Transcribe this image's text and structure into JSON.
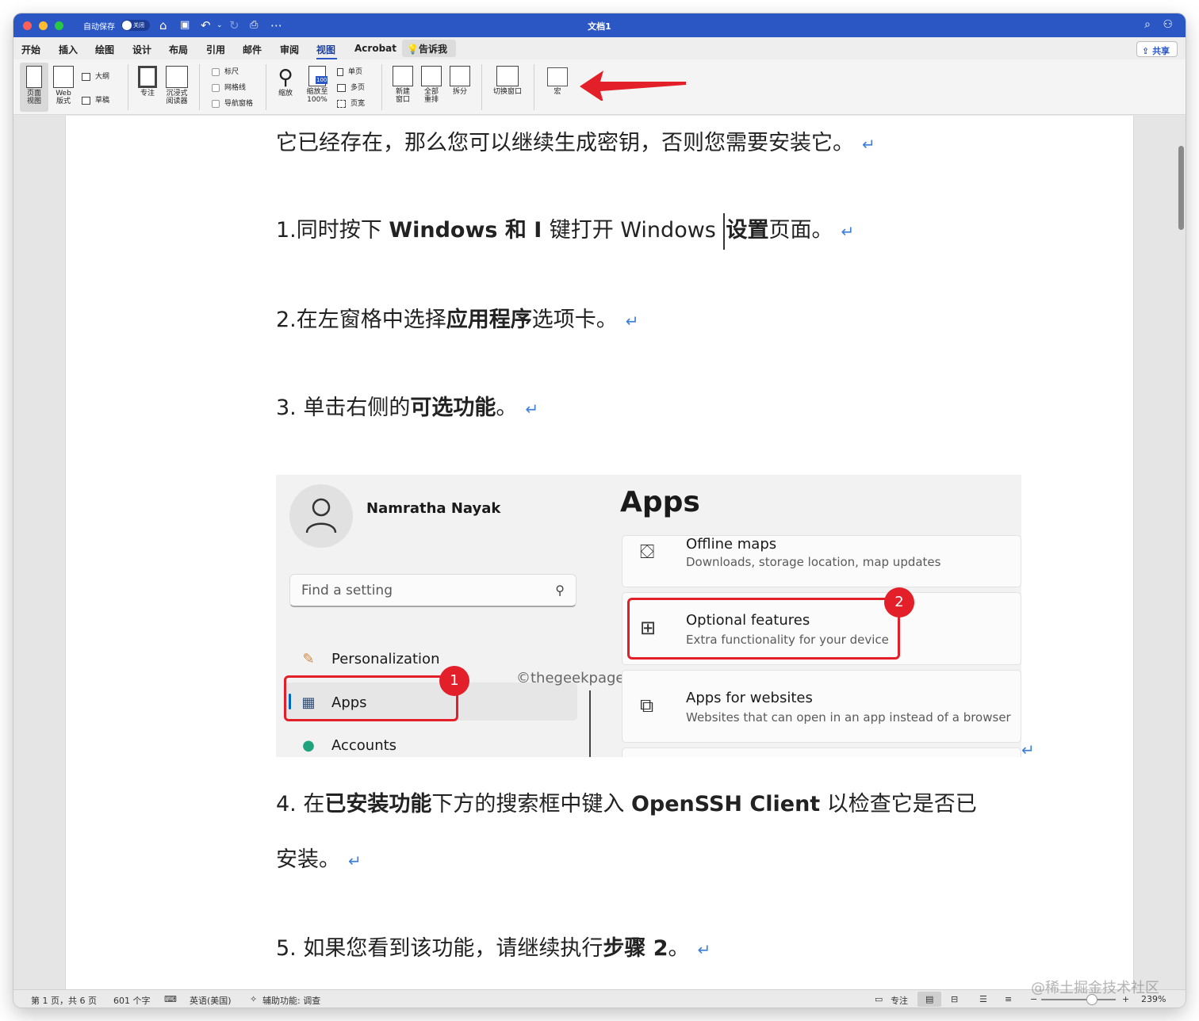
{
  "titlebar": {
    "autosave_label": "自动保存",
    "autosave_state": "关闭",
    "doc_title": "文档1"
  },
  "tabs": [
    "开始",
    "插入",
    "绘图",
    "设计",
    "布局",
    "引用",
    "邮件",
    "审阅",
    "视图",
    "Acrobat"
  ],
  "active_tab": "视图",
  "tellme": "告诉我",
  "share": "共享",
  "ribbon": {
    "page_view": "页面\n视图",
    "web_layout": "Web\n版式",
    "outline": "大纲",
    "draft": "草稿",
    "focus": "专注",
    "immersive_reader": "沉浸式\n阅读器",
    "ruler": "标尺",
    "gridlines": "网格线",
    "nav_pane": "导航窗格",
    "zoom": "缩放",
    "zoom_100": "缩放至\n100%",
    "one_page": "单页",
    "multi_page": "多页",
    "page_width": "页宽",
    "new_window": "新建\n窗口",
    "arrange_all": "全部\n重排",
    "split": "拆分",
    "switch_window": "切换窗口",
    "macros": "宏",
    "zoom_badge": "100"
  },
  "doc": {
    "line0": "它已经存在，那么您可以继续生成密钥，否则您需要安装它。",
    "line1_a": "1.同时按下 ",
    "line1_b": "Windows  和  I ",
    "line1_c": "键打开  Windows ",
    "line1_d": "设置",
    "line1_e": "页面。",
    "line2_a": "2.在左窗格中选择",
    "line2_b": "应用程序",
    "line2_c": "选项卡。",
    "line3_a": "3.  单击右侧的",
    "line3_b": "可选功能",
    "line3_c": "。",
    "line4_a": "4.  在",
    "line4_b": "已安装功能",
    "line4_c": "下方的搜索框中键入 ",
    "line4_d": "OpenSSH Client",
    "line4_e": " 以检查它是否已",
    "line4_wrap": "安装。",
    "line5_a": "5.  如果您看到该功能，请继续执行",
    "line5_b": "步骤  2",
    "line5_c": "。",
    "return_mark": "↵"
  },
  "screenshot": {
    "user_name": "Namratha Nayak",
    "title": "Apps",
    "search_placeholder": "Find a setting",
    "nav": [
      "Personalization",
      "Apps",
      "Accounts"
    ],
    "cards": [
      {
        "title": "Offline maps",
        "subtitle": "Downloads, storage location, map updates"
      },
      {
        "title": "Optional features",
        "subtitle": "Extra functionality for your device"
      },
      {
        "title": "Apps for websites",
        "subtitle": "Websites that can open in an app instead of a browser"
      }
    ],
    "badge1": "1",
    "badge2": "2",
    "watermark": "©thegeekpage.com"
  },
  "status": {
    "page": "第 1 页，共 6 页",
    "words": "601 个字",
    "language": "英语(美国)",
    "accessibility": "辅助功能: 调查",
    "focus": "专注",
    "zoom": "239%"
  },
  "corner_watermark": "@稀土掘金技术社区",
  "colors": {
    "titlebar": "#2b57c5",
    "annotation_red": "#e3202a",
    "return_mark": "#3f7fd6"
  }
}
